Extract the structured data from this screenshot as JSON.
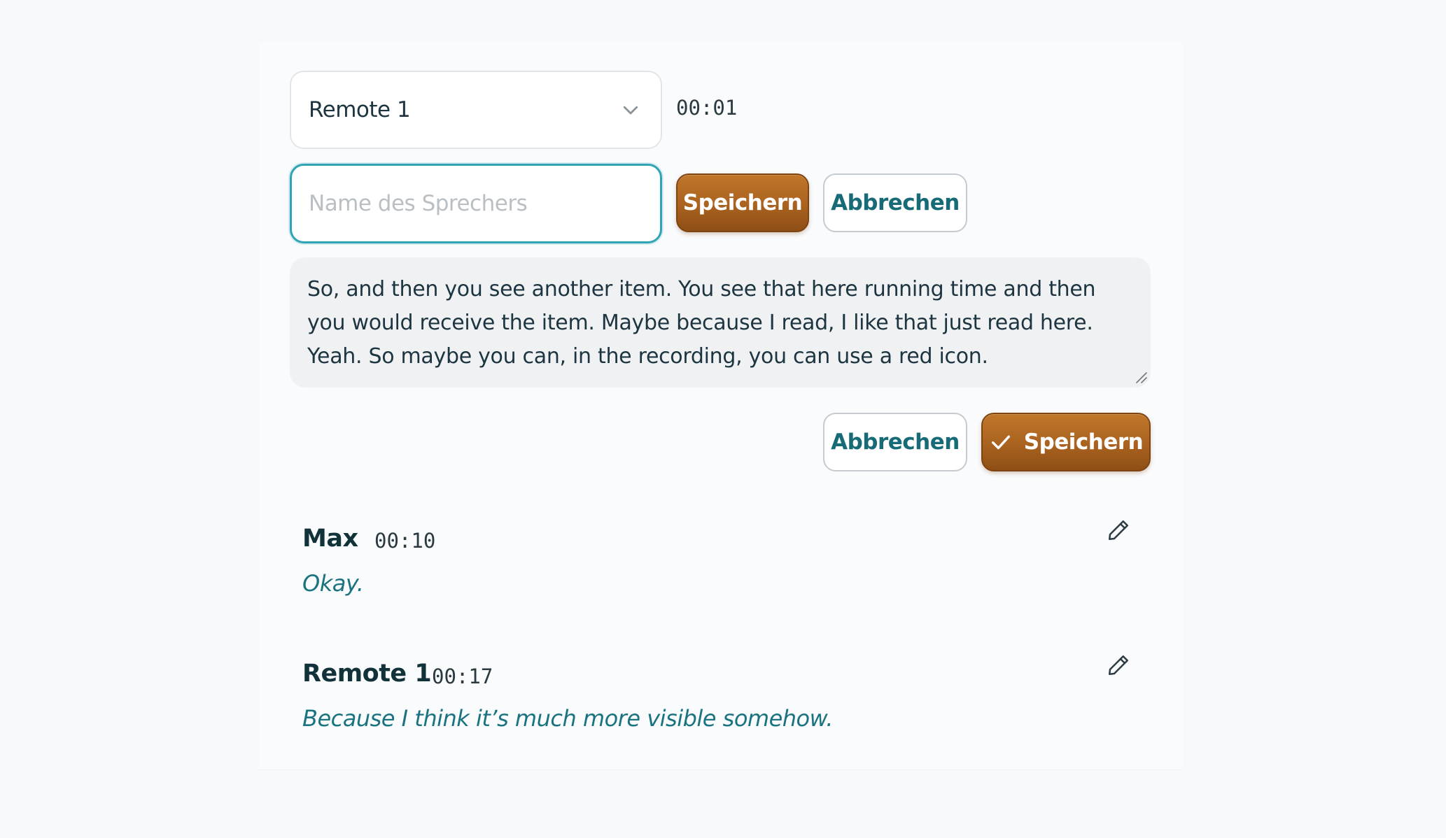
{
  "speaker_select": {
    "value": "Remote 1",
    "icon": "chevron-down-icon"
  },
  "current_time": "00:01",
  "name_input": {
    "placeholder": "Name des Sprechers",
    "value": ""
  },
  "name_form": {
    "save_label": "Speichern",
    "cancel_label": "Abbrechen"
  },
  "transcript_text": "So, and then you see another item. You see that here running time and then you would receive the item. Maybe because I read, I like that just read here. Yeah. So maybe you can, in the recording, you can use a red icon.",
  "edit_actions": {
    "cancel_label": "Abbrechen",
    "save_label": "Speichern",
    "save_icon": "check-icon"
  },
  "segments": [
    {
      "speaker": "Max",
      "time": "00:10",
      "text": "Okay.",
      "icon": "pencil-icon"
    },
    {
      "speaker": "Remote 1",
      "time": "00:17",
      "text": "Because I think it’s much more visible somehow.",
      "icon": "pencil-icon"
    }
  ],
  "colors": {
    "accent_teal": "#2fa4b4",
    "primary_button": "#a9621f",
    "secondary_text": "#176b77",
    "segment_text": "#1a7380"
  }
}
